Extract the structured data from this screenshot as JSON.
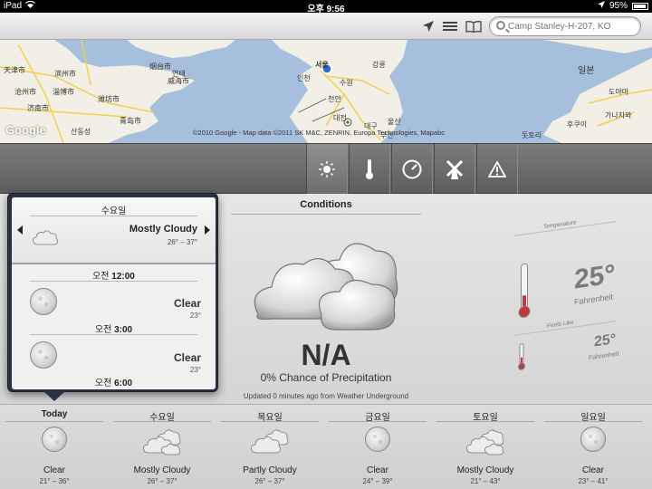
{
  "status": {
    "carrier": "iPad",
    "time": "오후 9:56",
    "battery": "95%",
    "wifi_icon": "wifi-icon",
    "location_icon": "location-arrow-icon"
  },
  "toolbar": {
    "icons": [
      "location-arrow-icon",
      "list-icon",
      "bookmarks-icon"
    ],
    "search_placeholder": "Camp Stanley-H-207, KO"
  },
  "map": {
    "google_logo": "Google",
    "copyright": "©2010 Google - Map data ©2011 SK M&C, ZENRIN, Europa Technologies, Mapabc",
    "labels": [
      "서울",
      "인천",
      "수원",
      "천안",
      "대전",
      "대구",
      "울산",
      "부산",
      "강릉",
      "일본",
      "도야마",
      "가나자와",
      "후쿠이",
      "돗토리",
      "烟台市",
      "威海市",
      "青岛市",
      "济南市",
      "淄博市",
      "潍坊市",
      "天津市",
      "沧州市",
      "滨州市",
      "산동성",
      "연태"
    ]
  },
  "tabs": [
    {
      "name": "conditions",
      "icon": "sun-icon",
      "active": true
    },
    {
      "name": "temperature",
      "icon": "thermometer-icon",
      "active": false
    },
    {
      "name": "pressure",
      "icon": "gauge-icon",
      "active": false
    },
    {
      "name": "wind",
      "icon": "windmill-icon",
      "active": false
    },
    {
      "name": "alerts",
      "icon": "warning-icon",
      "active": false
    }
  ],
  "conditions": {
    "title": "Conditions",
    "value": "N/A",
    "precip": "0% Chance of Precipitation",
    "updated": "Updated 0 minutes ago from Weather Underground"
  },
  "temperature": {
    "label": "Temperature",
    "value": "25°",
    "unit": "Fahrenheit"
  },
  "feels_like": {
    "label": "Feels Like",
    "value": "25°",
    "unit": "Fahrenheit"
  },
  "popover": {
    "day": "수요일",
    "condition": "Mostly Cloudy",
    "range": "26° – 37°",
    "hours": [
      {
        "time_prefix": "오전",
        "time": "12:00",
        "condition": "Clear",
        "temp": "23°"
      },
      {
        "time_prefix": "오전",
        "time": "3:00",
        "condition": "Clear",
        "temp": "23°"
      },
      {
        "time_prefix": "오전",
        "time": "6:00",
        "condition": "",
        "temp": ""
      }
    ]
  },
  "forecast": [
    {
      "day": "Today",
      "condition": "Clear",
      "range": "21° – 36°",
      "icon": "moon-icon"
    },
    {
      "day": "수요일",
      "condition": "Mostly Cloudy",
      "range": "26° – 37°",
      "icon": "cloud-icon"
    },
    {
      "day": "목요일",
      "condition": "Partly Cloudy",
      "range": "26° – 37°",
      "icon": "cloud-icon"
    },
    {
      "day": "금요일",
      "condition": "Clear",
      "range": "24° – 39°",
      "icon": "moon-icon"
    },
    {
      "day": "토요일",
      "condition": "Mostly Cloudy",
      "range": "21° – 43°",
      "icon": "cloud-icon"
    },
    {
      "day": "일요일",
      "condition": "Clear",
      "range": "23° – 41°",
      "icon": "moon-icon"
    }
  ]
}
